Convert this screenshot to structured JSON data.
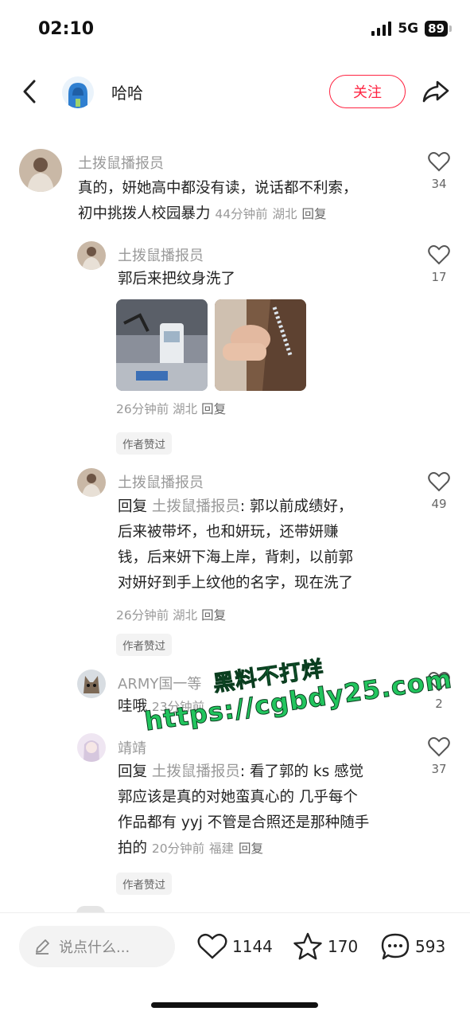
{
  "status": {
    "time": "02:10",
    "network": "5G",
    "battery": "89"
  },
  "header": {
    "user_name": "哈哈",
    "follow_label": "关注",
    "back_icon": "chevron-left-icon",
    "share_icon": "share-arrow-icon"
  },
  "comments": [
    {
      "name": "土拨鼠播报员",
      "text_line1": "真的，妍她高中都没有读，说话都不利索，",
      "text_line2": "初中挑拨人校园暴力",
      "time": "44分钟前",
      "location": "湖北",
      "reply": "回复",
      "likes": "34"
    },
    {
      "name": "土拨鼠播报员",
      "text": "郭后来把纹身洗了",
      "time": "26分钟前",
      "location": "湖北",
      "reply": "回复",
      "likes": "17",
      "badge": "作者赞过"
    },
    {
      "name": "土拨鼠播报员",
      "reply_prefix": "回复",
      "reply_to": "土拨鼠播报员",
      "text_line1": ": 郭以前成绩好，",
      "text_line2": "后来被带坏，也和妍玩，还带妍赚",
      "text_line3": "钱，后来妍下海上岸，背刺，以前郭",
      "text_line4": "对妍好到手上纹他的名字，现在洗了",
      "time": "26分钟前",
      "location": "湖北",
      "reply": "回复",
      "likes": "49",
      "badge": "作者赞过"
    },
    {
      "name": "ARMY国一等",
      "text": "哇哦",
      "time": "23分钟前",
      "likes": "2"
    },
    {
      "name": "靖靖",
      "reply_prefix": "回复",
      "reply_to": "土拨鼠播报员",
      "text_line1": ": 看了郭的 ks 感觉",
      "text_line2": "郭应该是真的对她蛮真心的 几乎每个",
      "text_line3": "作品都有 yyj 不管是合照还是那种随手",
      "text_line4": "拍的",
      "time": "20分钟前",
      "location": "福建",
      "reply": "回复",
      "likes": "37",
      "badge": "作者赞过"
    }
  ],
  "watermark": {
    "line1": "黑料不打烊",
    "line2": "https://cgbdy25.com"
  },
  "bottom": {
    "input_placeholder": "说点什么...",
    "likes": "1144",
    "collects": "170",
    "comments": "593"
  }
}
